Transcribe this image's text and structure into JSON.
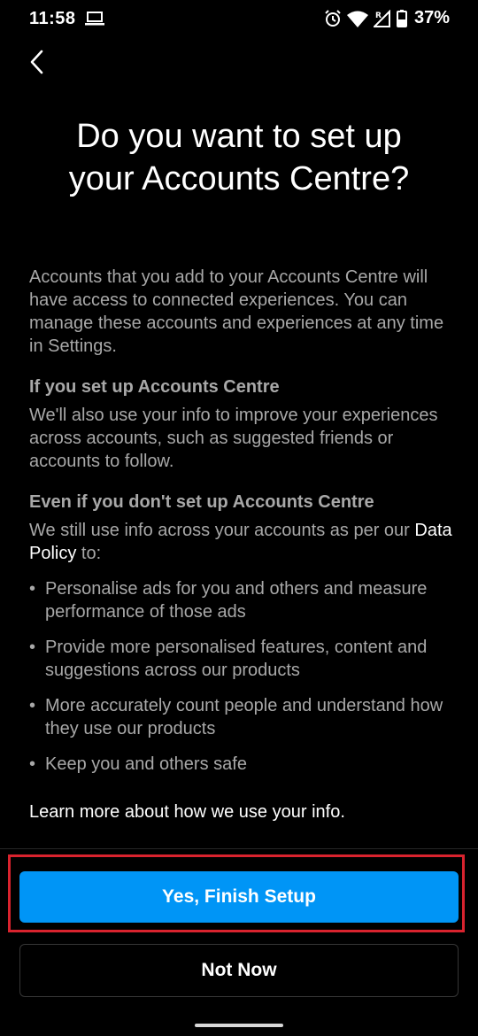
{
  "status_bar": {
    "time": "11:58",
    "battery_percent": "37%",
    "icons": [
      "laptop-icon",
      "alarm-icon",
      "wifi-icon",
      "signal-icon",
      "battery-icon"
    ]
  },
  "header": {
    "back_icon": "chevron-left-icon",
    "title": "Do you want to set up your Accounts Centre?"
  },
  "body": {
    "intro": "Accounts that you add to your Accounts Centre will have access to connected experiences. You can manage these accounts and experiences at any time in Settings.",
    "section1": {
      "heading": "If you set up Accounts Centre",
      "text": "We'll also use your info to improve your experiences across accounts, such as suggested friends or accounts to follow."
    },
    "section2": {
      "heading": "Even if you don't set up Accounts Centre",
      "text_before_link": "We still use info across your accounts as per our ",
      "link": "Data Policy",
      "text_after_link": " to:",
      "bullets": [
        "Personalise ads for you and others and measure performance of those ads",
        "Provide more personalised features, content and suggestions across our products",
        "More accurately count people and understand how they use our products",
        "Keep you and others safe"
      ],
      "bullet_char": "•"
    },
    "learn_more": "Learn more about how we use your info."
  },
  "actions": {
    "primary_label": "Yes, Finish Setup",
    "secondary_label": "Not Now"
  },
  "colors": {
    "background": "#000000",
    "primary_button": "#0095f6",
    "highlight_border": "#d9232e",
    "body_text": "#a8a8a8"
  }
}
